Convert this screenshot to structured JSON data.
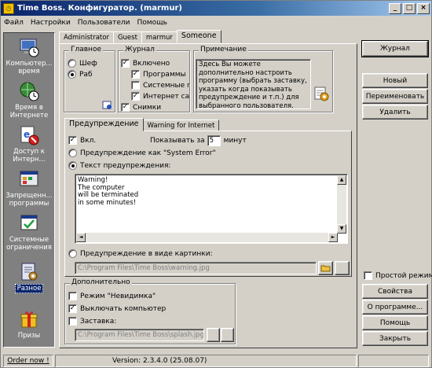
{
  "window": {
    "title": "Time Boss. Конфигуратор. (marmur)",
    "icon": "app-logo-icon"
  },
  "menubar": {
    "items": [
      "Файл",
      "Настройки",
      "Пользователи",
      "Помощь"
    ]
  },
  "sidebar": {
    "items": [
      {
        "label": "Компьютер... время",
        "icon": "computer-time-icon"
      },
      {
        "label": "Время в Интернете",
        "icon": "internet-time-icon"
      },
      {
        "label": "Доступ к Интерн...",
        "icon": "internet-access-icon"
      },
      {
        "label": "Запрещенн... программы",
        "icon": "forbidden-programs-icon"
      },
      {
        "label": "Системные ограничения",
        "icon": "system-restrictions-icon"
      },
      {
        "label": "Разное",
        "icon": "misc-icon"
      },
      {
        "label": "Призы",
        "icon": "prizes-icon"
      }
    ],
    "selected": "Разное"
  },
  "user_tabs": [
    "Administrator",
    "Guest",
    "marmur",
    "Someone"
  ],
  "active_user_tab": "Someone",
  "main_group": {
    "title": "Главное",
    "options": [
      "Шеф",
      "Раб"
    ],
    "selected": "Раб"
  },
  "journal_group": {
    "title": "Журнал",
    "items": [
      {
        "label": "Включено",
        "checked": true
      },
      {
        "label": "Программы",
        "checked": true
      },
      {
        "label": "Системные прс",
        "checked": false
      },
      {
        "label": "Интернет сайт",
        "checked": true
      },
      {
        "label": "Снимки",
        "checked": true
      }
    ]
  },
  "note_group": {
    "title": "Примечание",
    "text": "Здесь Вы можете дополнительно настроить программу (выбрать заставку, указать когда показывать предупреждение и т.п.) для выбранного пользователя."
  },
  "warning_tabs": [
    "Предупреждение",
    "Warning for Internet"
  ],
  "warning": {
    "enabled_label": "Вкл.",
    "enabled": true,
    "show_for_label": "Показывать за",
    "show_for_value": "5",
    "minutes_label": "минут",
    "option_system_error": "Предупреждение как \"System Error\"",
    "option_text": "Текст предупреждения:",
    "text_lines": [
      "Warning!",
      "The computer",
      "will be terminated",
      "in some minutes!"
    ],
    "option_picture": "Предупреждение в виде картинки:",
    "picture_path": "C:\\Program Files\\Time Boss\\warning.jpg",
    "selected_option": "text"
  },
  "extra_group": {
    "title": "Дополнительно",
    "invisible_label": "Режим \"Невидимка\"",
    "invisible": false,
    "shutdown_label": "Выключать компьютер",
    "shutdown": true,
    "splash_label": "Заставка:",
    "splash": false,
    "splash_path": "C:\\Program Files\\Time Boss\\splash.jpg"
  },
  "right_buttons": {
    "journal": "Журнал",
    "new": "Новый",
    "rename": "Переименовать",
    "delete": "Удалить",
    "simple_mode": "Простой режим",
    "properties": "Свойства",
    "about": "О программе...",
    "help": "Помощь",
    "close": "Закрыть"
  },
  "statusbar": {
    "order": "Order now !",
    "version": "Version: 2.3.4.0 (25.08.07)"
  }
}
